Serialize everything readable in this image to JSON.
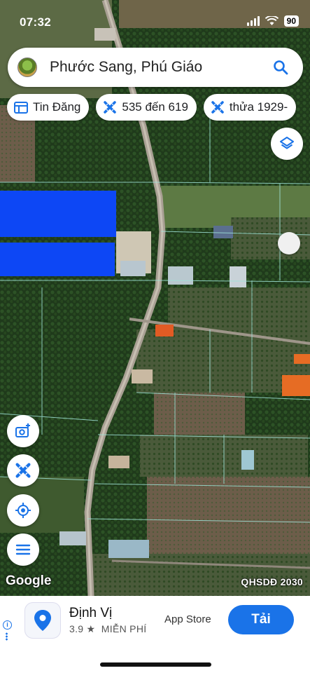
{
  "status_bar": {
    "time": "07:32",
    "battery": "90"
  },
  "search": {
    "query": "Phước Sang, Phú Giáo"
  },
  "chips": [
    {
      "label": "Tin Đăng",
      "icon": "calendar-icon"
    },
    {
      "label": "535 đến 619",
      "icon": "ruler-cross-icon"
    },
    {
      "label": "thửa 1929-",
      "icon": "ruler-cross-icon"
    }
  ],
  "map": {
    "attribution": "Google",
    "overlay_label": "QHSDĐ 2030",
    "colors": {
      "zone_blue": "#0d47f5",
      "parcel_lines": "#9fe3d8",
      "road": "#a9a094"
    }
  },
  "side_buttons": [
    "camera-add-icon",
    "ruler-cross-icon",
    "locate-icon",
    "menu-icon"
  ],
  "ad": {
    "app_name": "Định Vị",
    "rating": "3.9 ★",
    "price": "MIỄN PHÍ",
    "store": "App Store",
    "cta": "Tải"
  }
}
